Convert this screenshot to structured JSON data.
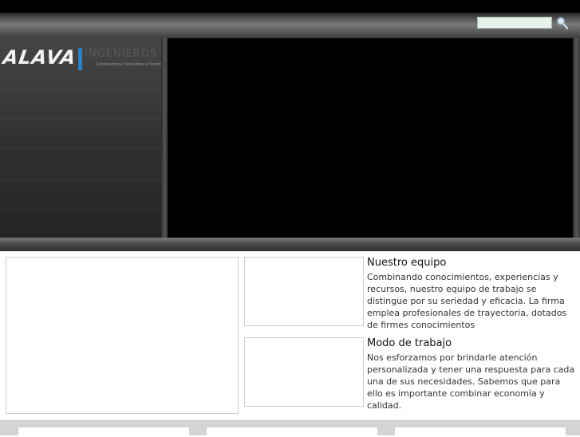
{
  "search": {
    "value": "",
    "placeholder": ""
  },
  "logo": {
    "name": "ALAVA",
    "subname": "INGENIEROS",
    "tagline": "Constructora Consultora e Inmobiliaria"
  },
  "sections": [
    {
      "title": "Nuestro equipo",
      "text": "Combinando conocimientos, experiencias y recursos, nuestro equipo de trabajo se distingue por su seriedad y eficacia. La firma emplea profesionales de trayectoria, dotados de firmes conocimientos"
    },
    {
      "title": "Modo de trabajo",
      "text": "Nos esforzamos por brindarle atención personalizada y tener una respuesta para cada una de sus necesidades. Sabemos que para ello es importante combinar economía y calidad."
    }
  ],
  "icons": {
    "search": "search-icon"
  },
  "colors": {
    "logo_accent": "#2a82c6",
    "search_field": "#e8f0ea"
  }
}
